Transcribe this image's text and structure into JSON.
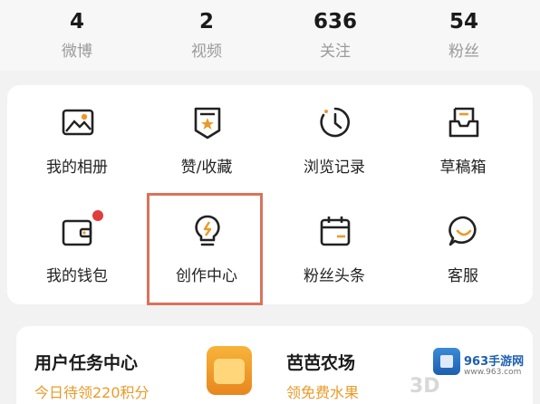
{
  "stats": [
    {
      "value": "4",
      "label": "微博"
    },
    {
      "value": "2",
      "label": "视频"
    },
    {
      "value": "636",
      "label": "关注"
    },
    {
      "value": "54",
      "label": "粉丝"
    }
  ],
  "grid": [
    {
      "label": "我的相册",
      "icon": "photo-album-icon"
    },
    {
      "label": "赞/收藏",
      "icon": "favorite-star-icon"
    },
    {
      "label": "浏览记录",
      "icon": "history-clock-icon"
    },
    {
      "label": "草稿箱",
      "icon": "draft-box-icon"
    },
    {
      "label": "我的钱包",
      "icon": "wallet-icon"
    },
    {
      "label": "创作中心",
      "icon": "lightbulb-icon"
    },
    {
      "label": "粉丝头条",
      "icon": "calendar-icon"
    },
    {
      "label": "客服",
      "icon": "customer-service-icon"
    }
  ],
  "task": {
    "title": "用户任务中心",
    "subtitle": "今日待领220积分"
  },
  "farm": {
    "title": "芭芭农场",
    "subtitle": "领免费水果"
  },
  "watermark": {
    "brand": "963手游网",
    "site": "www.963.com",
    "mark": "3D"
  },
  "colors": {
    "accent": "#e89b2a",
    "highlight": "#d9735a",
    "badge": "#e23b3b"
  }
}
